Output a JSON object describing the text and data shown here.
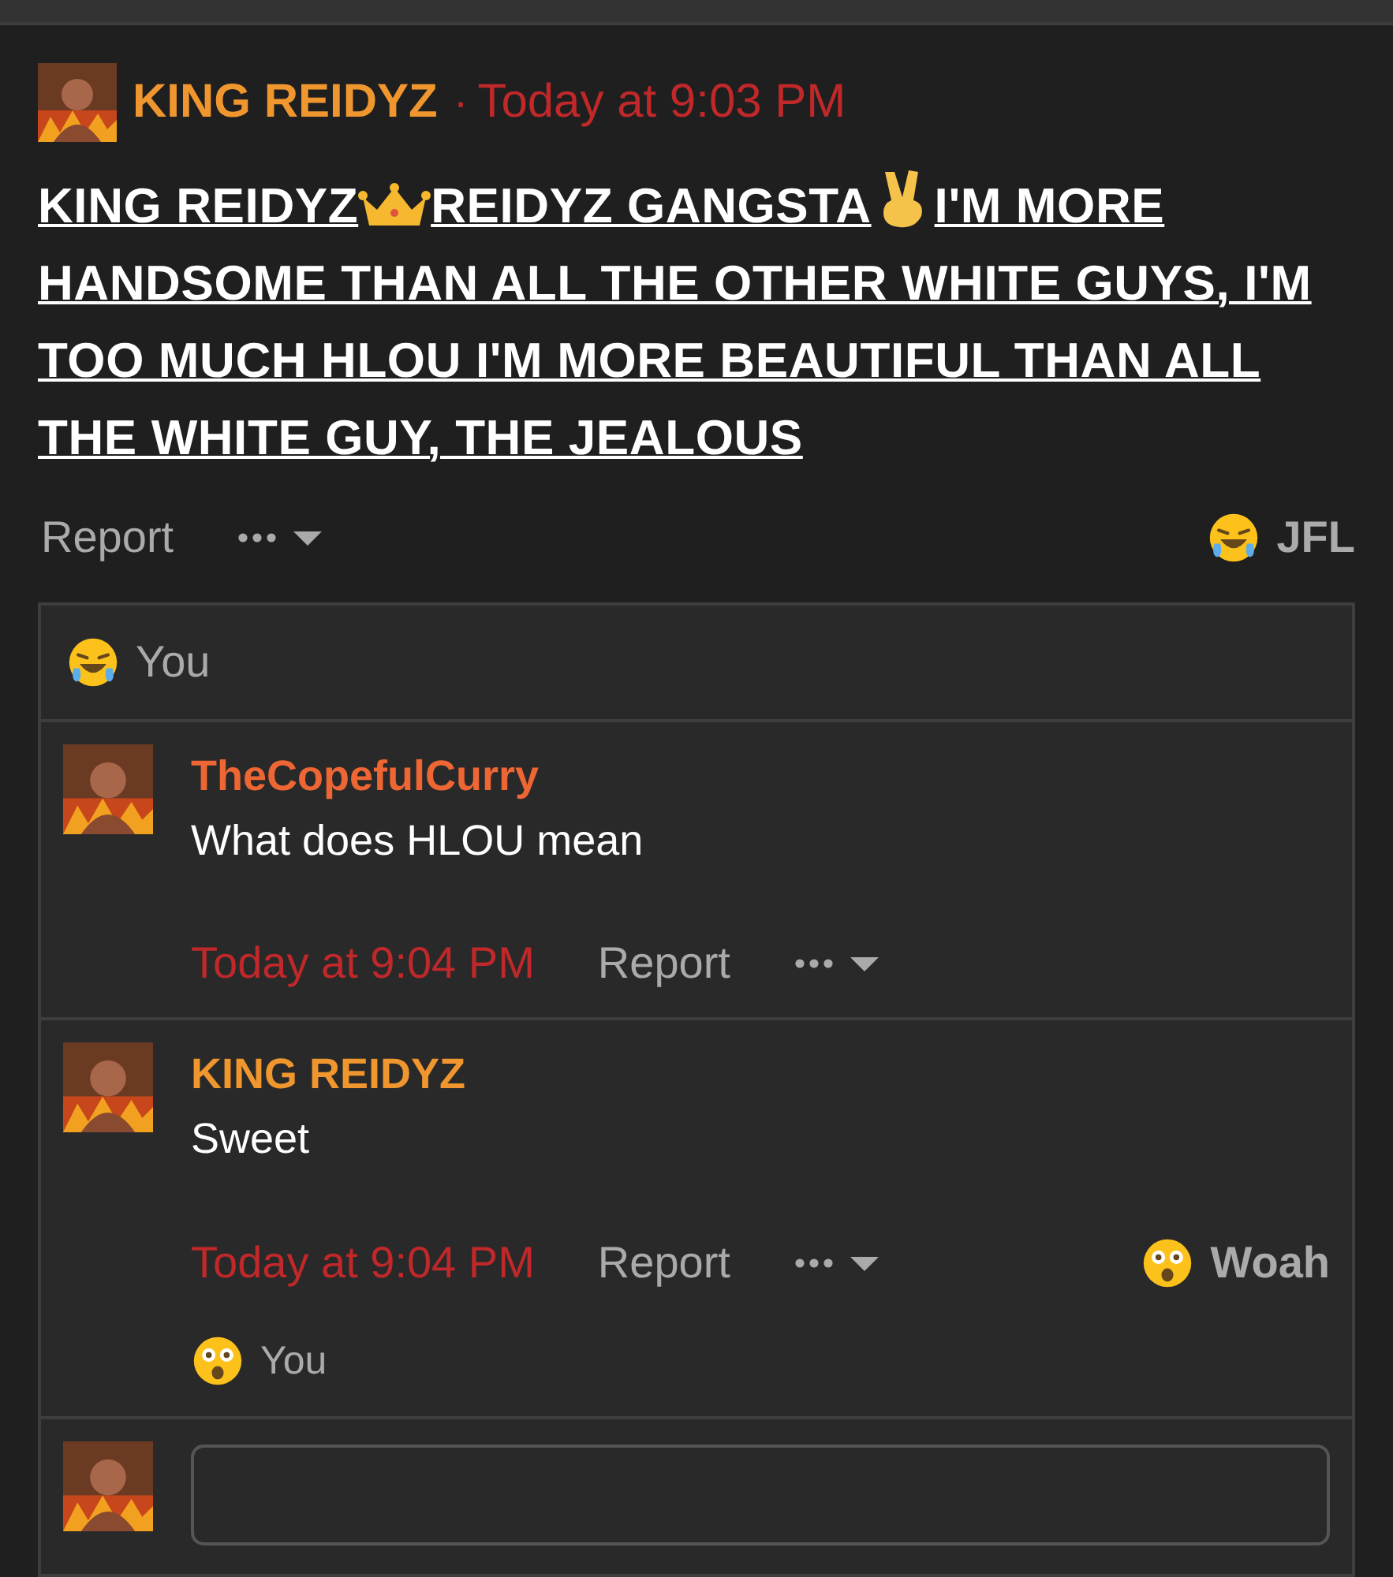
{
  "post": {
    "author": "KING REIDYZ",
    "separator": "·",
    "time": "Today at 9:03 PM",
    "message_parts": [
      "KING REIDYZ",
      "REIDYZ GANGSTA",
      "I'M MORE HANDSOME THAN ALL THE OTHER WHITE GUYS, I'M TOO MUCH HLOU I'M MORE BEAUTIFUL THAN ALL THE WHITE GUY, THE JEALOUS"
    ],
    "report": "Report",
    "reaction": {
      "kind": "laugh",
      "label": "JFL"
    }
  },
  "reaction_summary": {
    "kind": "laugh",
    "text": "You"
  },
  "comments": [
    {
      "author": "TheCopefulCurry",
      "color": "#ee6633",
      "text": "What does HLOU mean",
      "time": "Today at 9:04 PM",
      "report": "Report"
    },
    {
      "author": "KING REIDYZ",
      "color": "#f0962e",
      "text": "Sweet",
      "time": "Today at 9:04 PM",
      "report": "Report",
      "reaction": {
        "kind": "wow",
        "label": "Woah"
      },
      "reaction_summary": {
        "kind": "wow",
        "text": "You"
      }
    }
  ]
}
